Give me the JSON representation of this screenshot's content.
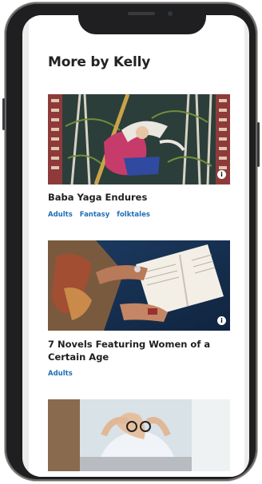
{
  "section": {
    "title": "More by Kelly"
  },
  "cards": [
    {
      "title": "Baba Yaga Endures",
      "tags": [
        "Adults",
        "Fantasy",
        "folktales"
      ],
      "image": "illustrated-folk-art-artwork",
      "info_icon": "info-icon"
    },
    {
      "title": "7 Novels Featuring Women of a Certain Age",
      "tags": [
        "Adults"
      ],
      "image": "hands-holding-open-book-photo",
      "info_icon": "info-icon"
    },
    {
      "image": "person-with-glasses-at-laptop-photo"
    }
  ],
  "colors": {
    "tag_link": "#1f6fb5",
    "title_text": "#222222"
  }
}
